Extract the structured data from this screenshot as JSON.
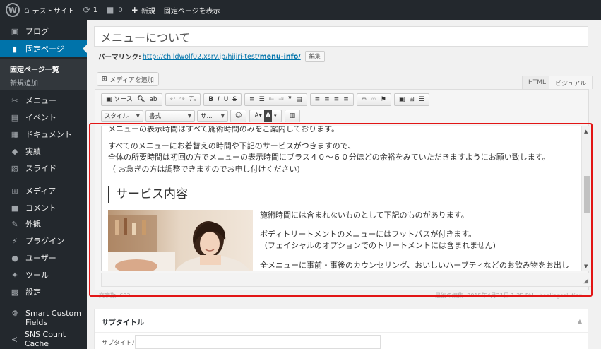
{
  "adminbar": {
    "site_name": "テストサイト",
    "updates_count": "1",
    "comments_count": "0",
    "new_label": "新規",
    "view_label": "固定ページを表示"
  },
  "sidebar": {
    "items": [
      {
        "label": "ブログ",
        "icon": "pin-icon"
      },
      {
        "label": "固定ページ",
        "icon": "page-icon"
      },
      {
        "label": "メニュー",
        "icon": "menu-icon"
      },
      {
        "label": "イベント",
        "icon": "event-icon"
      },
      {
        "label": "ドキュメント",
        "icon": "document-icon"
      },
      {
        "label": "実績",
        "icon": "tag-icon"
      },
      {
        "label": "スライド",
        "icon": "slide-icon"
      },
      {
        "label": "メディア",
        "icon": "media-icon"
      },
      {
        "label": "コメント",
        "icon": "comment-icon"
      },
      {
        "label": "外観",
        "icon": "brush-icon"
      },
      {
        "label": "プラグイン",
        "icon": "plugin-icon"
      },
      {
        "label": "ユーザー",
        "icon": "user-icon"
      },
      {
        "label": "ツール",
        "icon": "wrench-icon"
      },
      {
        "label": "設定",
        "icon": "settings-icon"
      },
      {
        "label": "Smart Custom Fields",
        "icon": "gear-icon"
      },
      {
        "label": "SNS Count Cache",
        "icon": "share-icon"
      }
    ],
    "submenu": {
      "list_label": "固定ページ一覧",
      "add_label": "新規追加"
    }
  },
  "editor": {
    "title_value": "メニューについて",
    "permalink_label": "パーマリンク:",
    "permalink_url_base": "http://childwolf02.xsrv.jp/hijiri-test/",
    "permalink_slug": "menu-info/",
    "edit_button": "編集",
    "add_media_button": "メディアを追加",
    "tab_html": "HTML",
    "tab_visual": "ビジュアル",
    "toolbar": {
      "source_label": "ソース",
      "style_select": "スタイル",
      "format_select": "書式",
      "size_select": "サ..."
    },
    "content": {
      "line0": "メニューの表示時間はすべて施術時間のみをご案内しております。",
      "line1": "すべてのメニューにお着替えの時間や下記のサービスがつきますので、",
      "line2": "全体の所要時間は初回の方でメニューの表示時間にプラス４０～６０分ほどの余裕をみていただきますようにお願い致します。",
      "line3": "（ お急ぎの方は調整できますのでお申し付けください)",
      "heading": "サービス内容",
      "line4": "施術時間には含まれないものとして下記のものがあります。",
      "line5": "ボディトリートメントのメニューにはフットバスが付きます。",
      "line6": "（フェイシャルのオプションでのトリートメントには含まれません)",
      "line7": "全メニューに事前・事後のカウンセリング、おいしいハーブティなどのお飲み物をお出し"
    },
    "word_count": "文字数: 693",
    "last_edit": "最後の編集: 2015年4月21日 1:25 PM - healingsolution"
  },
  "postbox": {
    "title": "サブタイトル",
    "field_label": "サブタイトル"
  },
  "colors": {
    "admin_dark": "#23282d",
    "active_blue": "#0073aa",
    "highlight_red": "#e21515"
  }
}
